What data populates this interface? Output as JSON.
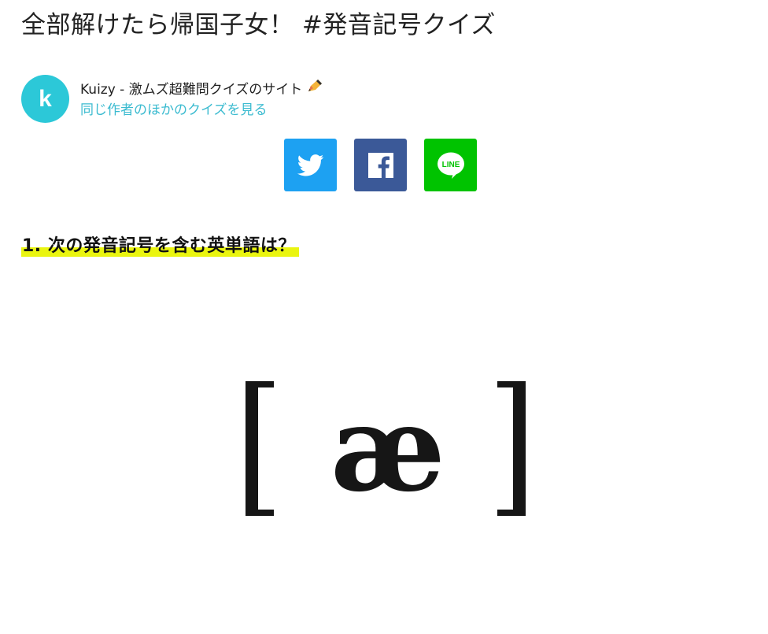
{
  "title": "全部解けたら帰国子女！ #発音記号クイズ",
  "author": {
    "avatar_letter": "k",
    "avatar_color": "#2cc8d8",
    "name": "Kuizy - 激ムズ超難問クイズのサイト",
    "more_quizzes_link": "同じ作者のほかのクイズを見る"
  },
  "share_buttons": [
    {
      "name": "twitter",
      "icon": "twitter-bird-icon",
      "color": "#1da1f2"
    },
    {
      "name": "facebook",
      "icon": "facebook-f-icon",
      "color": "#3b5998"
    },
    {
      "name": "line",
      "icon": "line-logo-icon",
      "color": "#00c300"
    }
  ],
  "question": {
    "label": "1. 次の発音記号を含む英単語は？",
    "highlight_color": "#eaf510",
    "image": {
      "open_bracket": "[",
      "symbol": "æ",
      "close_bracket": "]"
    }
  }
}
